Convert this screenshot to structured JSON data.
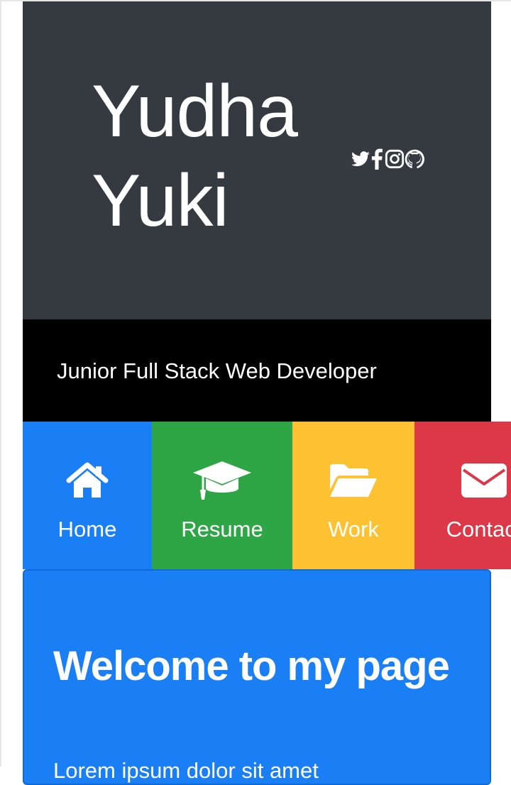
{
  "header": {
    "first_name": "Yudha",
    "last_name": "Yuki",
    "socials": [
      {
        "name": "twitter-icon"
      },
      {
        "name": "facebook-icon"
      },
      {
        "name": "instagram-icon"
      },
      {
        "name": "github-icon"
      }
    ],
    "tagline": "Junior Full Stack Web Developer"
  },
  "nav": {
    "items": [
      {
        "label": "Home",
        "icon": "home-icon",
        "color": "#1a7ef5"
      },
      {
        "label": "Resume",
        "icon": "graduation-cap-icon",
        "color": "#2ea646"
      },
      {
        "label": "Work",
        "icon": "folder-open-icon",
        "color": "#fdc132"
      },
      {
        "label": "Contact",
        "icon": "envelope-icon",
        "color": "#dc3847"
      }
    ]
  },
  "welcome": {
    "title": "Welcome to my page",
    "body": "Lorem ipsum dolor sit amet"
  },
  "colors": {
    "header_bg": "#343a40",
    "tagline_bg": "#000000",
    "card_bg": "#1a7ef5"
  }
}
